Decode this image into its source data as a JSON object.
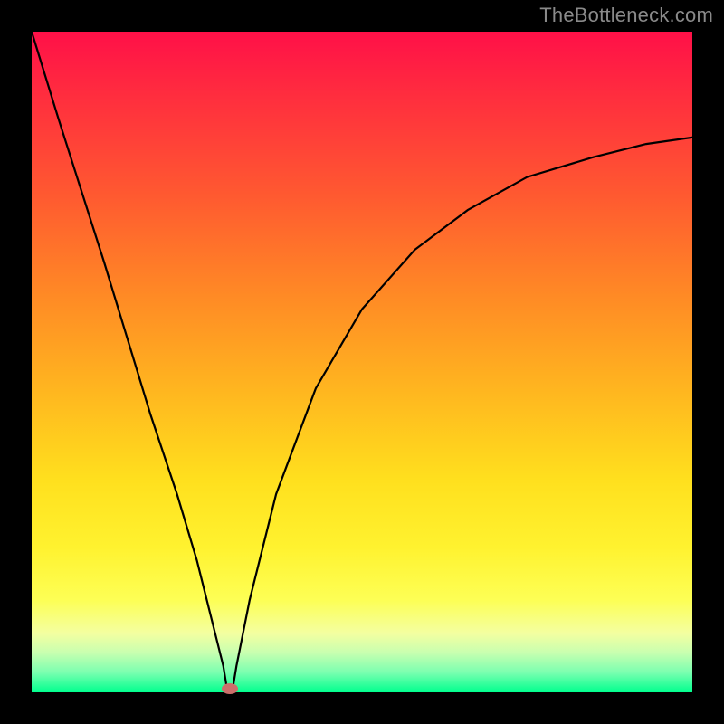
{
  "chart_data": {
    "type": "line",
    "title": "",
    "xlabel": "",
    "ylabel": "",
    "xlim": [
      0,
      1
    ],
    "ylim": [
      0,
      1
    ],
    "series": [
      {
        "name": "bottleneck-curve",
        "x": [
          0.0,
          0.04,
          0.11,
          0.18,
          0.22,
          0.25,
          0.27,
          0.29,
          0.295,
          0.3,
          0.305,
          0.31,
          0.33,
          0.37,
          0.43,
          0.5,
          0.58,
          0.66,
          0.75,
          0.85,
          0.93,
          1.0
        ],
        "y": [
          1.0,
          0.87,
          0.65,
          0.42,
          0.3,
          0.2,
          0.12,
          0.04,
          0.01,
          0.0,
          0.01,
          0.04,
          0.14,
          0.3,
          0.46,
          0.58,
          0.67,
          0.73,
          0.78,
          0.81,
          0.83,
          0.84
        ]
      }
    ],
    "optimum_marker": {
      "x": 0.3,
      "y": 0.0
    }
  },
  "watermark": "TheBottleneck.com",
  "colors": {
    "curve": "#000000",
    "dot": "#cc6f6b",
    "frame": "#000000"
  }
}
